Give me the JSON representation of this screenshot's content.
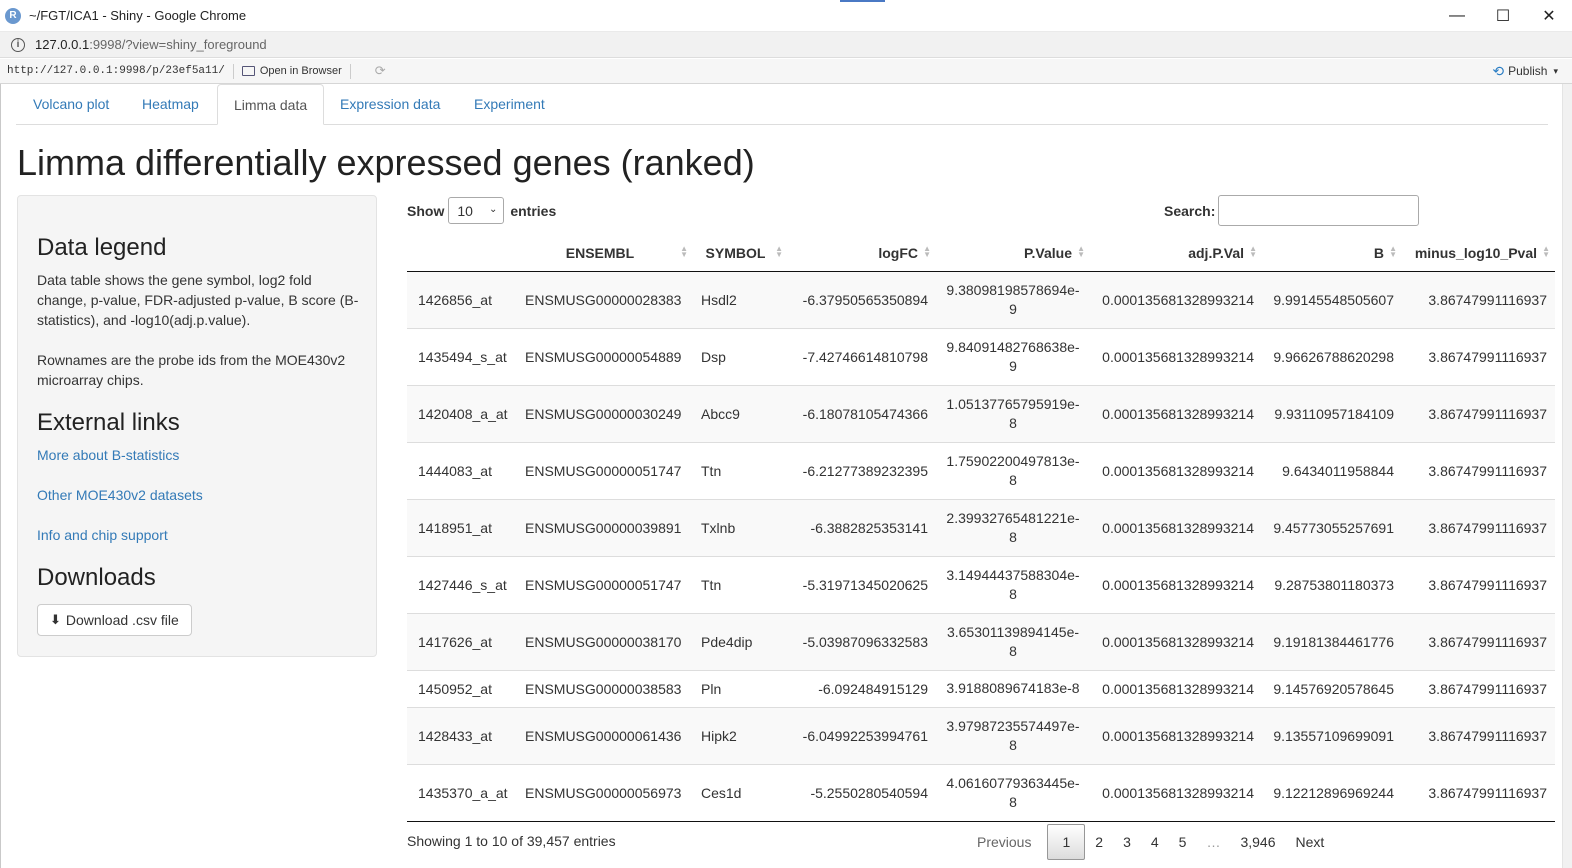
{
  "window": {
    "title": "~/FGT/ICA1 - Shiny - Google Chrome",
    "app_icon": "R",
    "controls": {
      "minimize": "—",
      "maximize": "☐",
      "close": "✕"
    }
  },
  "address": {
    "host": "127.0.0.1",
    "rest": ":9998/?view=shiny_foreground"
  },
  "rstudio_bar": {
    "url": "http://127.0.0.1:9998/p/23ef5a11/",
    "open_label": "Open in Browser",
    "publish_label": "Publish"
  },
  "tabs": [
    {
      "label": "Volcano plot",
      "active": false
    },
    {
      "label": "Heatmap",
      "active": false
    },
    {
      "label": "Limma data",
      "active": true
    },
    {
      "label": "Expression data",
      "active": false
    },
    {
      "label": "Experiment",
      "active": false
    }
  ],
  "page_title": "Limma differentially expressed genes (ranked)",
  "sidebar": {
    "legend_heading": "Data legend",
    "legend_text_1": "Data table shows the gene symbol, log2 fold change, p-value, FDR-adjusted p-value, B score (B-statistics), and -log10(adj.p.value).",
    "legend_text_2": "Rownames are the probe ids from the MOE430v2 microarray chips.",
    "links_heading": "External links",
    "links": [
      "More about B-statistics",
      "Other MOE430v2 datasets",
      "Info and chip support"
    ],
    "downloads_heading": "Downloads",
    "download_label": "Download .csv file"
  },
  "table": {
    "show_label": "Show",
    "entries_value": "10",
    "entries_label": "entries",
    "search_label": "Search:",
    "columns": [
      "",
      "ENSEMBL",
      "SYMBOL",
      "logFC",
      "P.Value",
      "adj.P.Val",
      "B",
      "minus_log10_Pval"
    ],
    "rows": [
      [
        "1426856_at",
        "ENSMUSG00000028383",
        "Hsdl2",
        "-6.37950565350894",
        "9.38098198578694e-9",
        "0.000135681328993214",
        "9.99145548505607",
        "3.86747991116937"
      ],
      [
        "1435494_s_at",
        "ENSMUSG00000054889",
        "Dsp",
        "-7.42746614810798",
        "9.84091482768638e-9",
        "0.000135681328993214",
        "9.96626788620298",
        "3.86747991116937"
      ],
      [
        "1420408_a_at",
        "ENSMUSG00000030249",
        "Abcc9",
        "-6.18078105474366",
        "1.05137765795919e-8",
        "0.000135681328993214",
        "9.93110957184109",
        "3.86747991116937"
      ],
      [
        "1444083_at",
        "ENSMUSG00000051747",
        "Ttn",
        "-6.21277389232395",
        "1.75902200497813e-8",
        "0.000135681328993214",
        "9.6434011958844",
        "3.86747991116937"
      ],
      [
        "1418951_at",
        "ENSMUSG00000039891",
        "Txlnb",
        "-6.3882825353141",
        "2.39932765481221e-8",
        "0.000135681328993214",
        "9.45773055257691",
        "3.86747991116937"
      ],
      [
        "1427446_s_at",
        "ENSMUSG00000051747",
        "Ttn",
        "-5.31971345020625",
        "3.14944437588304e-8",
        "0.000135681328993214",
        "9.28753801180373",
        "3.86747991116937"
      ],
      [
        "1417626_at",
        "ENSMUSG00000038170",
        "Pde4dip",
        "-5.03987096332583",
        "3.65301139894145e-8",
        "0.000135681328993214",
        "9.19181384461776",
        "3.86747991116937"
      ],
      [
        "1450952_at",
        "ENSMUSG00000038583",
        "Pln",
        "-6.092484915129",
        "3.9188089674183e-8",
        "0.000135681328993214",
        "9.14576920578645",
        "3.86747991116937"
      ],
      [
        "1428433_at",
        "ENSMUSG00000061436",
        "Hipk2",
        "-6.04992253994761",
        "3.97987235574497e-8",
        "0.000135681328993214",
        "9.13557109699091",
        "3.86747991116937"
      ],
      [
        "1435370_a_at",
        "ENSMUSG00000056973",
        "Ces1d",
        "-5.2550280540594",
        "4.06160779363445e-8",
        "0.000135681328993214",
        "9.12212896969244",
        "3.86747991116937"
      ]
    ],
    "info": "Showing 1 to 10 of 39,457 entries",
    "pager": {
      "previous": "Previous",
      "pages": [
        "1",
        "2",
        "3",
        "4",
        "5"
      ],
      "ellipsis": "…",
      "last": "3,946",
      "next": "Next"
    }
  }
}
